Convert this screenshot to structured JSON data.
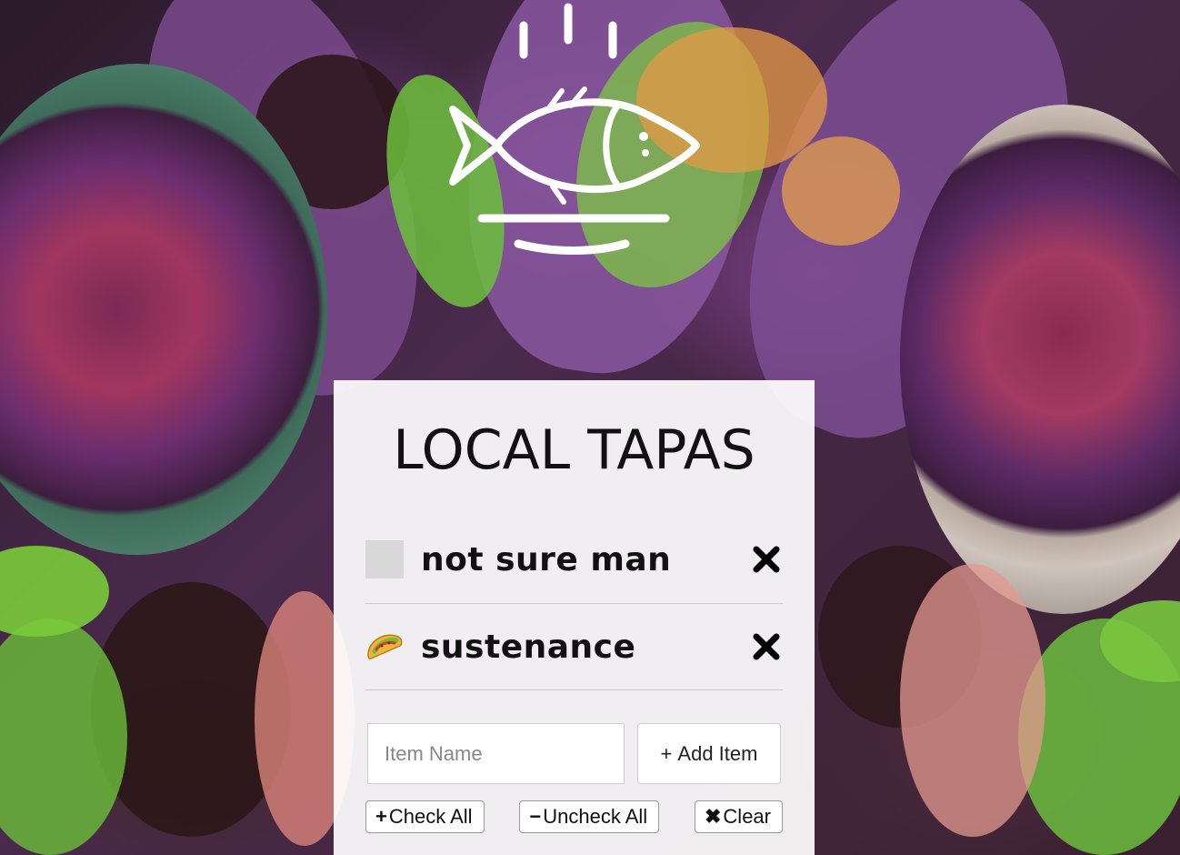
{
  "app": {
    "title": "LOCAL TAPAS",
    "logo_icon": "fish-on-plate-icon"
  },
  "list": {
    "items": [
      {
        "label": "not sure man",
        "checked": false,
        "status_icon": "unchecked-box",
        "delete_icon": "close-icon"
      },
      {
        "label": "sustenance",
        "checked": true,
        "status_icon": "taco-icon",
        "delete_icon": "close-icon"
      }
    ]
  },
  "form": {
    "input_placeholder": "Item Name",
    "input_value": "",
    "add_label": "Add Item",
    "add_icon": "+"
  },
  "actions": {
    "check_all": {
      "icon": "+",
      "label": "Check All"
    },
    "uncheck_all": {
      "icon": "−",
      "label": "Uncheck All"
    },
    "clear": {
      "icon": "✖",
      "label": "Clear"
    }
  },
  "colors": {
    "card_bg": "#ffffff",
    "text": "#111111",
    "unchecked_box": "#d8d8d8"
  }
}
